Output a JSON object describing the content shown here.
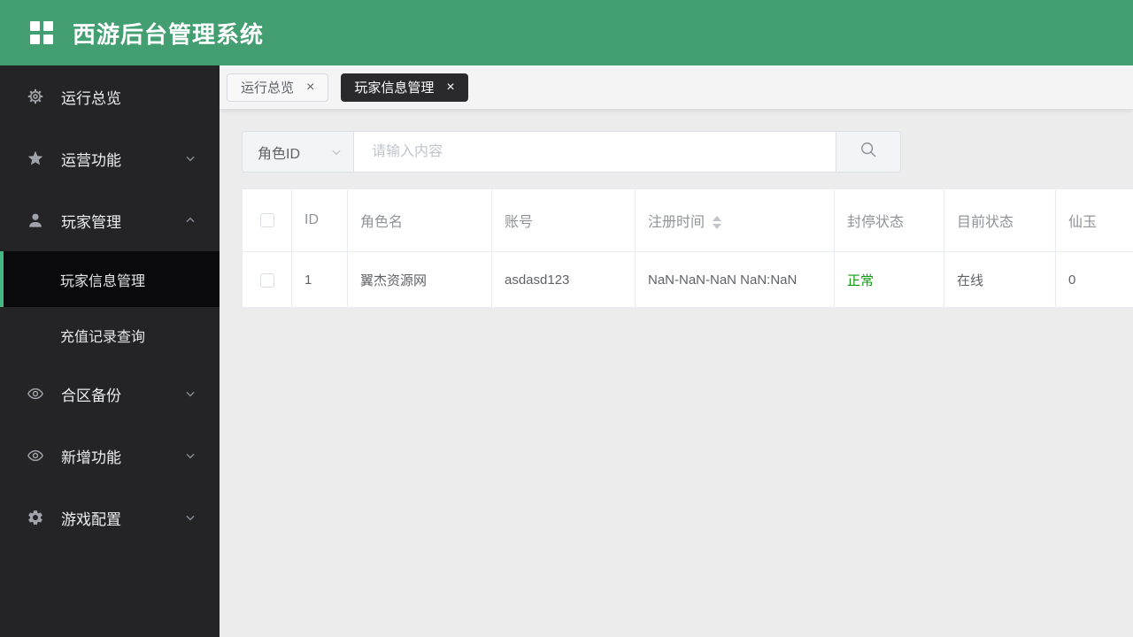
{
  "app": {
    "title": "西游后台管理系统"
  },
  "colors": {
    "brand_green": "#439f72",
    "sidebar_active_border": "#42b983",
    "status_normal_green": "#0a9b0a"
  },
  "ui": {
    "close_glyph": "×"
  },
  "sidebar": {
    "items": [
      {
        "label": "运行总览",
        "icon": "settings-gear-icon",
        "chevron": null
      },
      {
        "label": "运营功能",
        "icon": "star-icon",
        "chevron": "down"
      },
      {
        "label": "玩家管理",
        "icon": "user-icon",
        "chevron": "up",
        "children": [
          {
            "label": "玩家信息管理",
            "active": true
          },
          {
            "label": "充值记录查询",
            "active": false
          }
        ]
      },
      {
        "label": "合区备份",
        "icon": "eye-icon",
        "chevron": "down"
      },
      {
        "label": "新增功能",
        "icon": "eye-icon",
        "chevron": "down"
      },
      {
        "label": "游戏配置",
        "icon": "gear-icon",
        "chevron": "down"
      }
    ]
  },
  "tabs": [
    {
      "label": "运行总览",
      "active": false
    },
    {
      "label": "玩家信息管理",
      "active": true
    }
  ],
  "search": {
    "selected_field": "角色ID",
    "placeholder": "请输入内容",
    "value": ""
  },
  "table": {
    "columns": [
      "ID",
      "角色名",
      "账号",
      "注册时间",
      "封停状态",
      "目前状态",
      "仙玉"
    ],
    "sortable_column": "注册时间",
    "rows": [
      {
        "id": "1",
        "role_name": "翼杰资源网",
        "account": "asdasd123",
        "register_time": "NaN-NaN-NaN NaN:NaN",
        "ban_status": "正常",
        "current_status": "在线",
        "xian_yu": "0"
      }
    ]
  }
}
